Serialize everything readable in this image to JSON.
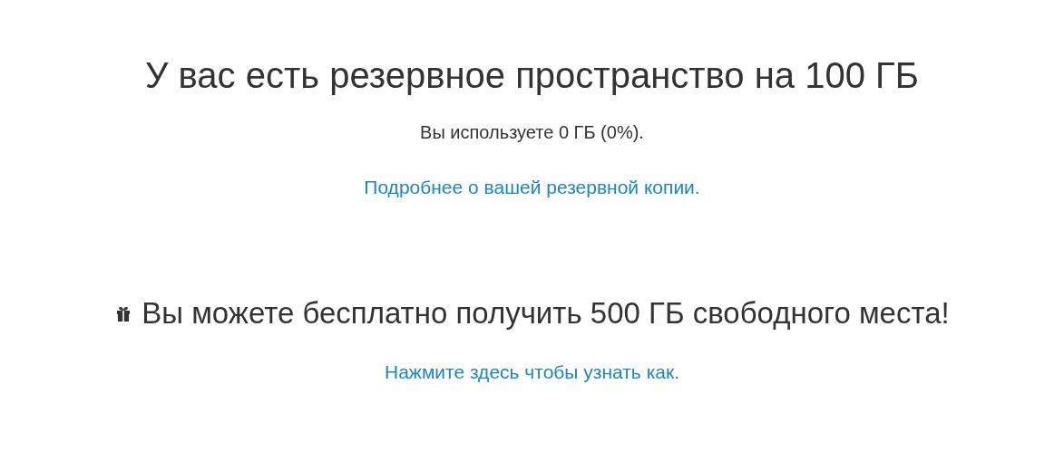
{
  "backup": {
    "title": "У вас есть резервное пространство на 100 ГБ",
    "usage": "Вы используете 0 ГБ (0%).",
    "details_link": "Подробнее о вашей резервной копии."
  },
  "offer": {
    "title": "Вы можете бесплатно получить 500 ГБ свободного места!",
    "link": "Нажмите здесь чтобы узнать как."
  }
}
